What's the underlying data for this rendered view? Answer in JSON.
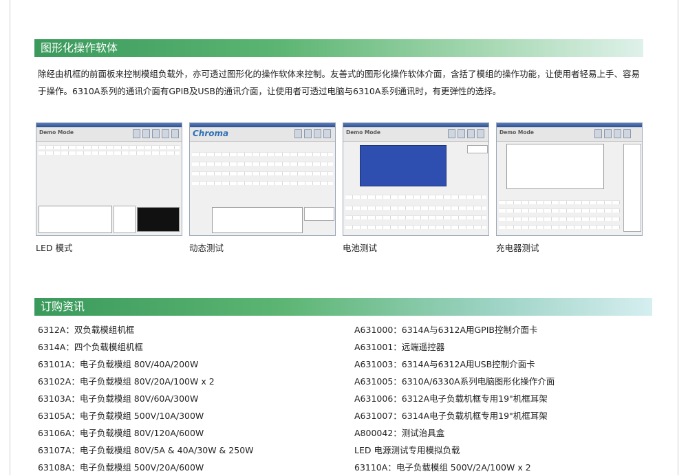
{
  "section1": {
    "title": "图形化操作软体"
  },
  "intro": {
    "text": "除经由机框的前面板来控制模组负载外，亦可透过图形化的操作软体来控制。友善式的图形化操作软体介面，含括了模组的操作功能，让使用者轻易上手、容易于操作。6310A系列的通讯介面有GPIB及USB的通讯介面，让使用者可透过电脑与6310A系列通讯时，有更弹性的选择。"
  },
  "screenshots": [
    {
      "header": "Demo Mode",
      "caption": "LED 模式"
    },
    {
      "header": "Chroma",
      "caption": "动态测试"
    },
    {
      "header": "Demo Mode",
      "caption": "电池测试"
    },
    {
      "header": "Demo Mode",
      "caption": "充电器测试"
    }
  ],
  "section2": {
    "title": "订购资讯"
  },
  "order_left": [
    "6312A：双负载模组机框",
    "6314A：四个负载模组机框",
    "63101A：电子负载模组 80V/40A/200W",
    "63102A：电子负载模组 80V/20A/100W x 2",
    "63103A：电子负载模组 80V/60A/300W",
    "63105A：电子负载模组 500V/10A/300W",
    "63106A：电子负载模组 80V/120A/600W",
    "63107A：电子负载模组 80V/5A & 40A/30W & 250W",
    "63108A：电子负载模组 500V/20A/600W"
  ],
  "order_right": [
    "A631000：6314A与6312A用GPIB控制介面卡",
    "A631001：远端遥控器",
    "A631003：6314A与6312A用USB控制介面卡",
    "A631005：6310A/6330A系列电脑图形化操作介面",
    "A631006：6312A电子负载机框专用19\"机框耳架",
    "A631007：6314A电子负载机框专用19\"机框耳架",
    "A800042：测试治具盒",
    "LED 电源测试专用模拟负载",
    "63110A：电子负载模组 500V/2A/100W x 2"
  ]
}
